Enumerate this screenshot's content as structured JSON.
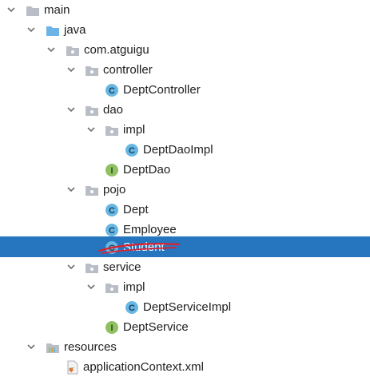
{
  "tree": {
    "main": "main",
    "java": "java",
    "package": "com.atguigu",
    "controller": "controller",
    "dept_controller": "DeptController",
    "dao": "dao",
    "dao_impl": "impl",
    "dept_dao_impl": "DeptDaoImpl",
    "dept_dao": "DeptDao",
    "pojo": "pojo",
    "dept": "Dept",
    "employee": "Employee",
    "student": "Student",
    "service": "service",
    "service_impl": "impl",
    "dept_service_impl": "DeptServiceImpl",
    "dept_service": "DeptService",
    "resources": "resources",
    "app_context": "applicationContext.xml"
  },
  "colors": {
    "selection": "#2675bf",
    "annotation": "#e0202a",
    "class_icon": "#67b7e3",
    "interface_icon": "#8fc162",
    "folder": "#b9bec6",
    "source_folder": "#6db4e6"
  }
}
